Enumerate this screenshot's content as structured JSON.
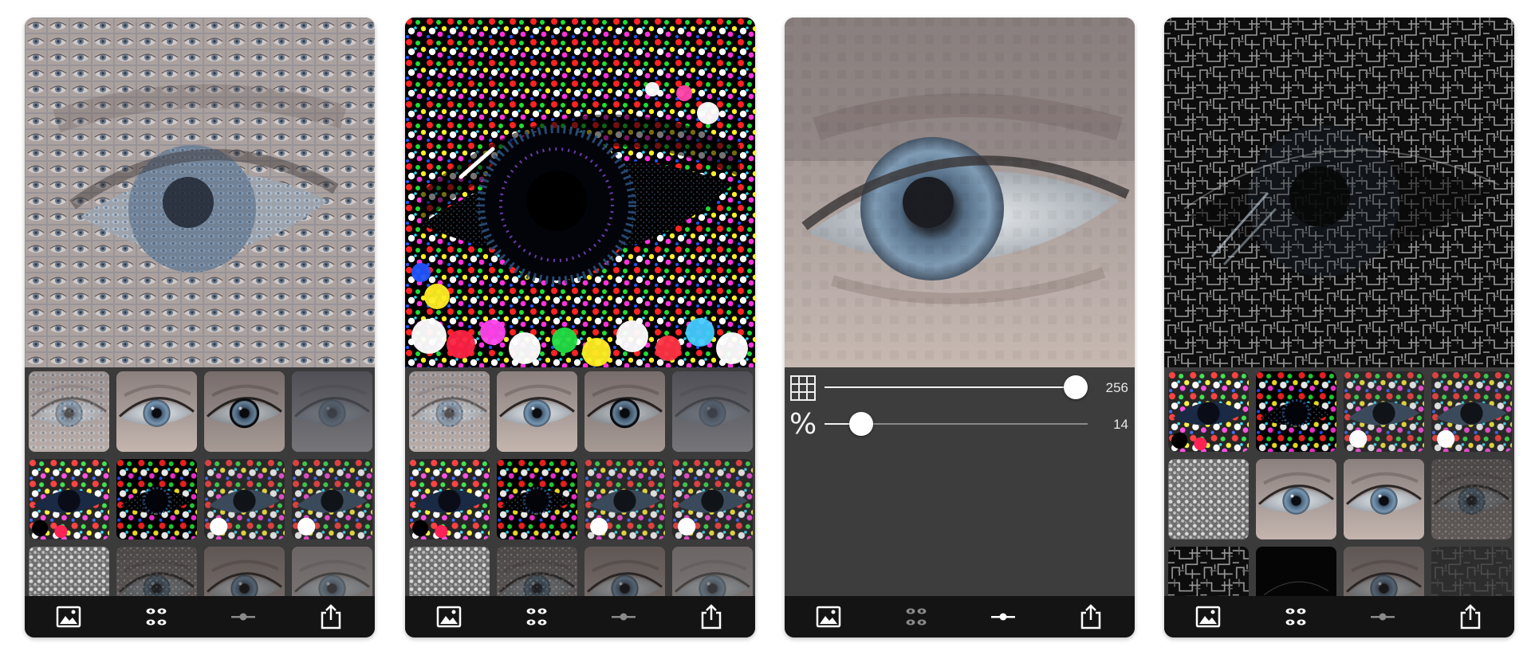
{
  "screens": [
    {
      "id": "screen-mosaic",
      "preview_style": "photo-mosaic-eye",
      "tab_active": "styles",
      "thumbnails": [
        "mosaic",
        "photo",
        "photo-contrast",
        "photo-dark",
        "dots-white",
        "dots-black",
        "dots-grey",
        "dots-grey",
        "pebbles",
        "dark-speckle",
        "photo-dim",
        "photo-faded"
      ]
    },
    {
      "id": "screen-dots",
      "preview_style": "color-dots-eye",
      "tab_active": "styles",
      "thumbnails": [
        "mosaic",
        "photo",
        "photo-contrast",
        "photo-dark",
        "dots-white",
        "dots-black",
        "dots-grey",
        "dots-grey",
        "pebbles",
        "dark-speckle",
        "photo-dim",
        "photo-faded"
      ]
    },
    {
      "id": "screen-adjust",
      "preview_style": "pixelated-eye",
      "tab_active": "adjust",
      "controls": [
        {
          "icon": "grid-icon",
          "value": 256,
          "max": 256,
          "value_label": "256"
        },
        {
          "icon": "percent-icon",
          "glyph": "%",
          "value": 14,
          "max": 100,
          "value_label": "14"
        }
      ]
    },
    {
      "id": "screen-circuit",
      "preview_style": "circuit-maze-eye",
      "tab_active": "styles",
      "thumbnails": [
        "dots-white",
        "dots-black",
        "dots-grey",
        "dots-grey",
        "pebbles",
        "photo",
        "photo",
        "dark-speckle",
        "circuit",
        "black",
        "photo-dim",
        "circuit-dark"
      ]
    }
  ],
  "tabbar": {
    "items": [
      {
        "name": "photo-library-tab",
        "icon": "image-icon"
      },
      {
        "name": "styles-tab",
        "icon": "styles-icon"
      },
      {
        "name": "adjust-tab",
        "icon": "slider-icon"
      },
      {
        "name": "share-tab",
        "icon": "share-icon"
      }
    ]
  },
  "colors": {
    "background": "#ffffff",
    "panel": "#3b3b3b",
    "tabbar": "#141414",
    "tab_active": "#ffffff",
    "tab_inactive": "#8a8a8a",
    "iris": "#6f8aa3"
  }
}
